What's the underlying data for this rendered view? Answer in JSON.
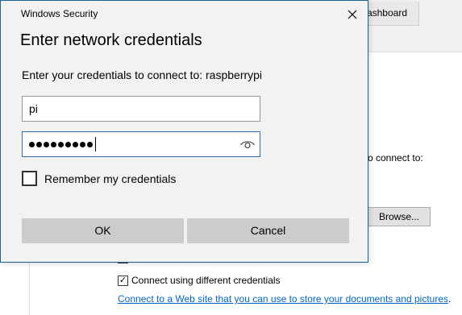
{
  "background": {
    "tab_label": "ashboard",
    "connect_to_text": "o connect to:",
    "browse_label": "Browse...",
    "different_credentials_label": "Connect using different credentials",
    "different_credentials_checked": true,
    "link_text": "Connect to a Web site that you can use to store your documents and pictures",
    "link_suffix": "."
  },
  "dialog": {
    "window_title": "Windows Security",
    "heading": "Enter network credentials",
    "prompt": "Enter your credentials to connect to: raspberrypi",
    "username_value": "pi",
    "password_masked_length": 9,
    "remember_label": "Remember my credentials",
    "remember_checked": false,
    "ok_label": "OK",
    "cancel_label": "Cancel"
  },
  "icons": {
    "close": "close-icon",
    "reveal_password": "eye-icon",
    "check": "checkmark-icon"
  },
  "colors": {
    "dialog_border": "#1e5f99",
    "focused_field_border": "#2b6cb3",
    "button_bg": "#cccccc",
    "link": "#0066cc"
  }
}
